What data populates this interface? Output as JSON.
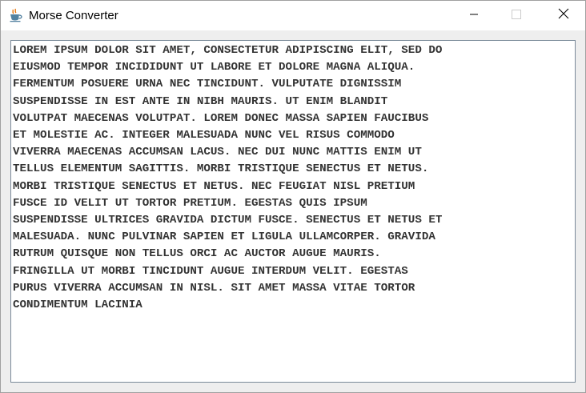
{
  "window": {
    "title": "Morse Converter",
    "icon": "java-coffee-cup-icon",
    "controls": {
      "minimize_icon": "minimize-icon",
      "maximize_icon": "maximize-icon",
      "close_icon": "close-icon"
    }
  },
  "editor": {
    "text": "LOREM IPSUM DOLOR SIT AMET, CONSECTETUR ADIPISCING ELIT, SED DO\nEIUSMOD TEMPOR INCIDIDUNT UT LABORE ET DOLORE MAGNA ALIQUA.\nFERMENTUM POSUERE URNA NEC TINCIDUNT. VULPUTATE DIGNISSIM\nSUSPENDISSE IN EST ANTE IN NIBH MAURIS. UT ENIM BLANDIT\nVOLUTPAT MAECENAS VOLUTPAT. LOREM DONEC MASSA SAPIEN FAUCIBUS\nET MOLESTIE AC. INTEGER MALESUADA NUNC VEL RISUS COMMODO\nVIVERRA MAECENAS ACCUMSAN LACUS. NEC DUI NUNC MATTIS ENIM UT\nTELLUS ELEMENTUM SAGITTIS. MORBI TRISTIQUE SENECTUS ET NETUS.\nMORBI TRISTIQUE SENECTUS ET NETUS. NEC FEUGIAT NISL PRETIUM\nFUSCE ID VELIT UT TORTOR PRETIUM. EGESTAS QUIS IPSUM\nSUSPENDISSE ULTRICES GRAVIDA DICTUM FUSCE. SENECTUS ET NETUS ET\nMALESUADA. NUNC PULVINAR SAPIEN ET LIGULA ULLAMCORPER. GRAVIDA\nRUTRUM QUISQUE NON TELLUS ORCI AC AUCTOR AUGUE MAURIS.\nFRINGILLA UT MORBI TINCIDUNT AUGUE INTERDUM VELIT. EGESTAS\nPURUS VIVERRA ACCUMSAN IN NISL. SIT AMET MASSA VITAE TORTOR\nCONDIMENTUM LACINIA"
  },
  "colors": {
    "text": "#333333",
    "content_background": "#eeeeee",
    "editor_border": "#7a8a99",
    "titlebar": "#ffffff"
  }
}
